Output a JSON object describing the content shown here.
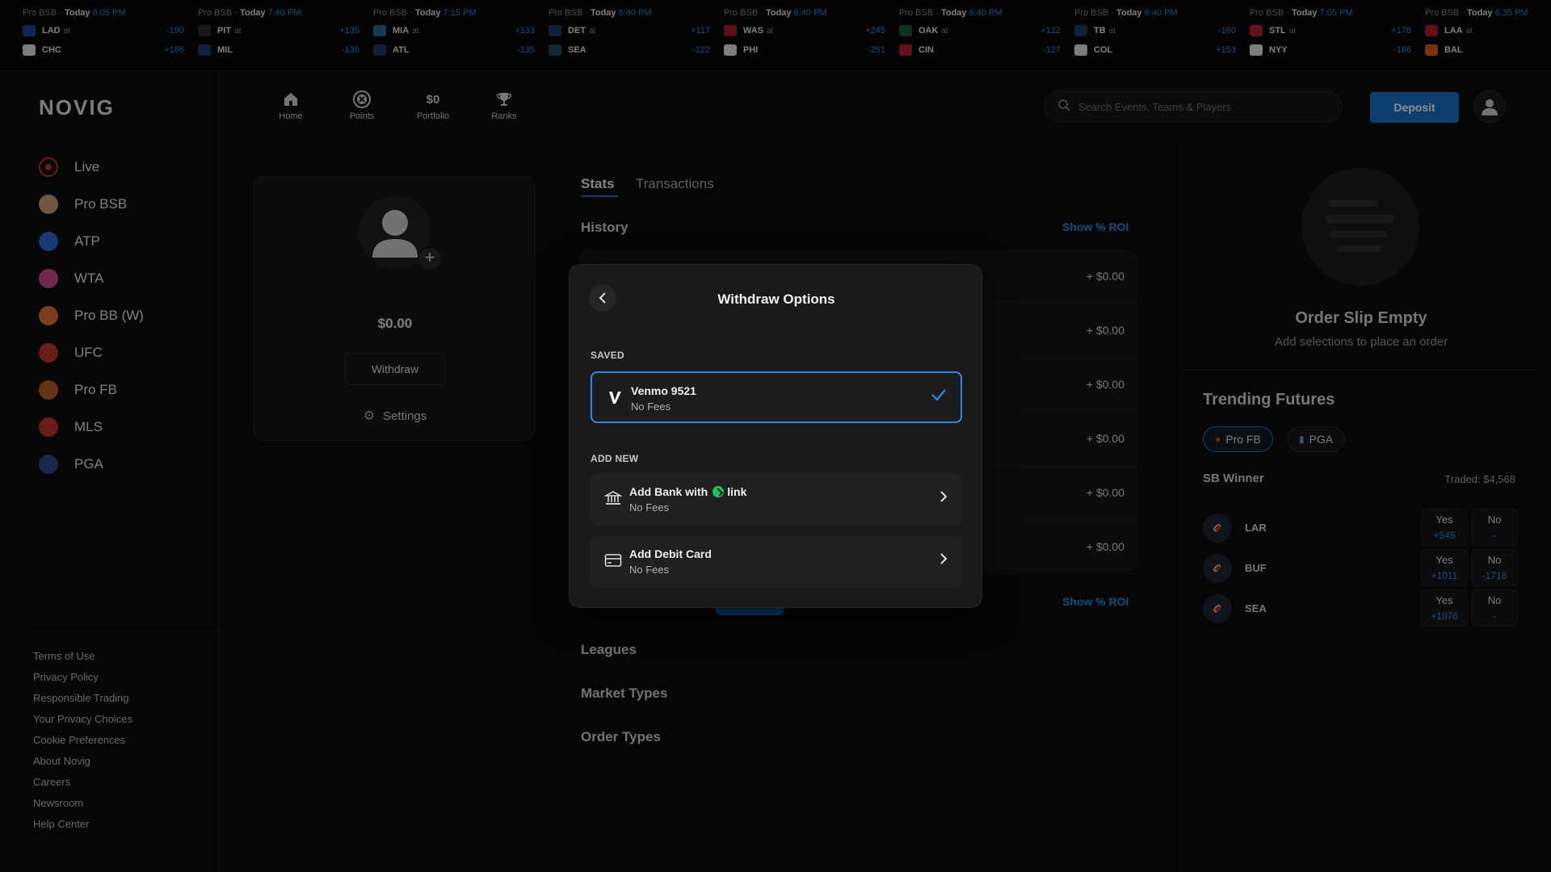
{
  "ticker": [
    {
      "league": "Pro BSB",
      "day": "Today",
      "time": "6:05 PM",
      "team1": "LAD",
      "odds1": "-190",
      "team2": "CHC",
      "odds2": "+186",
      "c1": "#1d4b8f",
      "c2": "#e4e4e4"
    },
    {
      "league": "Pro BSB",
      "day": "Today",
      "time": "7:40 PM",
      "team1": "PIT",
      "odds1": "+135",
      "team2": "MIL",
      "odds2": "-138",
      "c1": "#2a2a2a",
      "c2": "#1d3b6b"
    },
    {
      "league": "Pro BSB",
      "day": "Today",
      "time": "7:15 PM",
      "team1": "MIA",
      "odds1": "+133",
      "team2": "ATL",
      "odds2": "-135",
      "c1": "#2a6a9a",
      "c2": "#1d3b6b"
    },
    {
      "league": "Pro BSB",
      "day": "Today",
      "time": "6:40 PM",
      "team1": "DET",
      "odds1": "+117",
      "team2": "SEA",
      "odds2": "-122",
      "c1": "#1d3b6b",
      "c2": "#1d4b5b"
    },
    {
      "league": "Pro BSB",
      "day": "Today",
      "time": "6:40 PM",
      "team1": "WAS",
      "odds1": "+245",
      "team2": "PHI",
      "odds2": "-251",
      "c1": "#a81f2f",
      "c2": "#e4e4e4"
    },
    {
      "league": "Pro BSB",
      "day": "Today",
      "time": "6:40 PM",
      "team1": "OAK",
      "odds1": "+122",
      "team2": "CIN",
      "odds2": "-127",
      "c1": "#1f5a3a",
      "c2": "#b81f2a"
    },
    {
      "league": "Pro BSB",
      "day": "Today",
      "time": "6:40 PM",
      "team1": "TB",
      "odds1": "-160",
      "team2": "COL",
      "odds2": "+153",
      "c1": "#1d3b6b",
      "c2": "#e4e4e4"
    },
    {
      "league": "Pro BSB",
      "day": "Today",
      "time": "7:05 PM",
      "team1": "STL",
      "odds1": "+178",
      "team2": "NYY",
      "odds2": "-186",
      "c1": "#b81f2a",
      "c2": "#e4e4e4"
    },
    {
      "league": "Pro BSB",
      "day": "Today",
      "time": "6:35 PM",
      "team1": "LAA",
      "odds1": "",
      "team2": "BAL",
      "odds2": "",
      "c1": "#b81f2a",
      "c2": "#d8601a"
    }
  ],
  "at_label": "at",
  "brand": "NOVIG",
  "sidebar": {
    "items": [
      {
        "label": "Live",
        "icon": "live-icon",
        "color": "#c0392b"
      },
      {
        "label": "Pro BSB",
        "icon": "baseball-icon",
        "color": "#c8a07a"
      },
      {
        "label": "ATP",
        "icon": "atp-icon",
        "color": "#2a6ad0"
      },
      {
        "label": "WTA",
        "icon": "wta-icon",
        "color": "#d04a8a"
      },
      {
        "label": "Pro BB (W)",
        "icon": "basketball-icon",
        "color": "#e0703a"
      },
      {
        "label": "UFC",
        "icon": "ufc-icon",
        "color": "#c0392b"
      },
      {
        "label": "Pro FB",
        "icon": "football-icon",
        "color": "#b8602a"
      },
      {
        "label": "MLS",
        "icon": "mls-icon",
        "color": "#c0392b"
      },
      {
        "label": "PGA",
        "icon": "pga-icon",
        "color": "#2a4a8a"
      }
    ],
    "footer": [
      "Terms of Use",
      "Privacy Policy",
      "Responsible Trading",
      "Your Privacy Choices",
      "Cookie Preferences",
      "About Novig",
      "Careers",
      "Newsroom",
      "Help Center"
    ]
  },
  "header": {
    "nav": [
      {
        "label": "Home",
        "icon": "home-icon"
      },
      {
        "label": "Points",
        "icon": "points-icon"
      },
      {
        "label": "Portfolio",
        "icon": "portfolio-value",
        "value": "$0"
      },
      {
        "label": "Ranks",
        "icon": "trophy-icon"
      }
    ],
    "search_placeholder": "Search Events, Teams & Players",
    "deposit_label": "Deposit"
  },
  "profile": {
    "balance": "$0.00",
    "withdraw_label": "Withdraw",
    "settings_label": "Settings"
  },
  "stats": {
    "tabs": [
      "Stats",
      "Transactions"
    ],
    "history_title": "History",
    "show_roi": "Show % ROI",
    "history_rows": [
      "+ $0.00",
      "+ $0.00",
      "+ $0.00",
      "+ $0.00",
      "+ $0.00",
      "+ $0.00"
    ],
    "sections": [
      "Leagues",
      "Market Types",
      "Order Types"
    ]
  },
  "order_slip": {
    "title": "Order Slip Empty",
    "subtitle": "Add selections to place an order"
  },
  "trending": {
    "title": "Trending Futures",
    "chips": [
      "Pro FB",
      "PGA"
    ],
    "market": "SB Winner",
    "traded": "Traded: $4,568",
    "rows": [
      {
        "team": "LAR",
        "yes_label": "Yes",
        "yes_odds": "+545",
        "no_label": "No",
        "no_odds": "-"
      },
      {
        "team": "BUF",
        "yes_label": "Yes",
        "yes_odds": "+1011",
        "no_label": "No",
        "no_odds": "-1718"
      },
      {
        "team": "SEA",
        "yes_label": "Yes",
        "yes_odds": "+1076",
        "no_label": "No",
        "no_odds": "-"
      }
    ]
  },
  "modal": {
    "title": "Withdraw Options",
    "saved_label": "SAVED",
    "add_new_label": "ADD NEW",
    "saved_option": {
      "title": "Venmo 9521",
      "subtitle": "No Fees"
    },
    "bank_option": {
      "title_prefix": "Add Bank with",
      "title_suffix": "link",
      "subtitle": "No Fees"
    },
    "card_option": {
      "title": "Add Debit Card",
      "subtitle": "No Fees"
    }
  },
  "colors": {
    "accent": "#1873c8",
    "link_green": "#1fc25a",
    "odds_blue": "#2a8ce0"
  }
}
